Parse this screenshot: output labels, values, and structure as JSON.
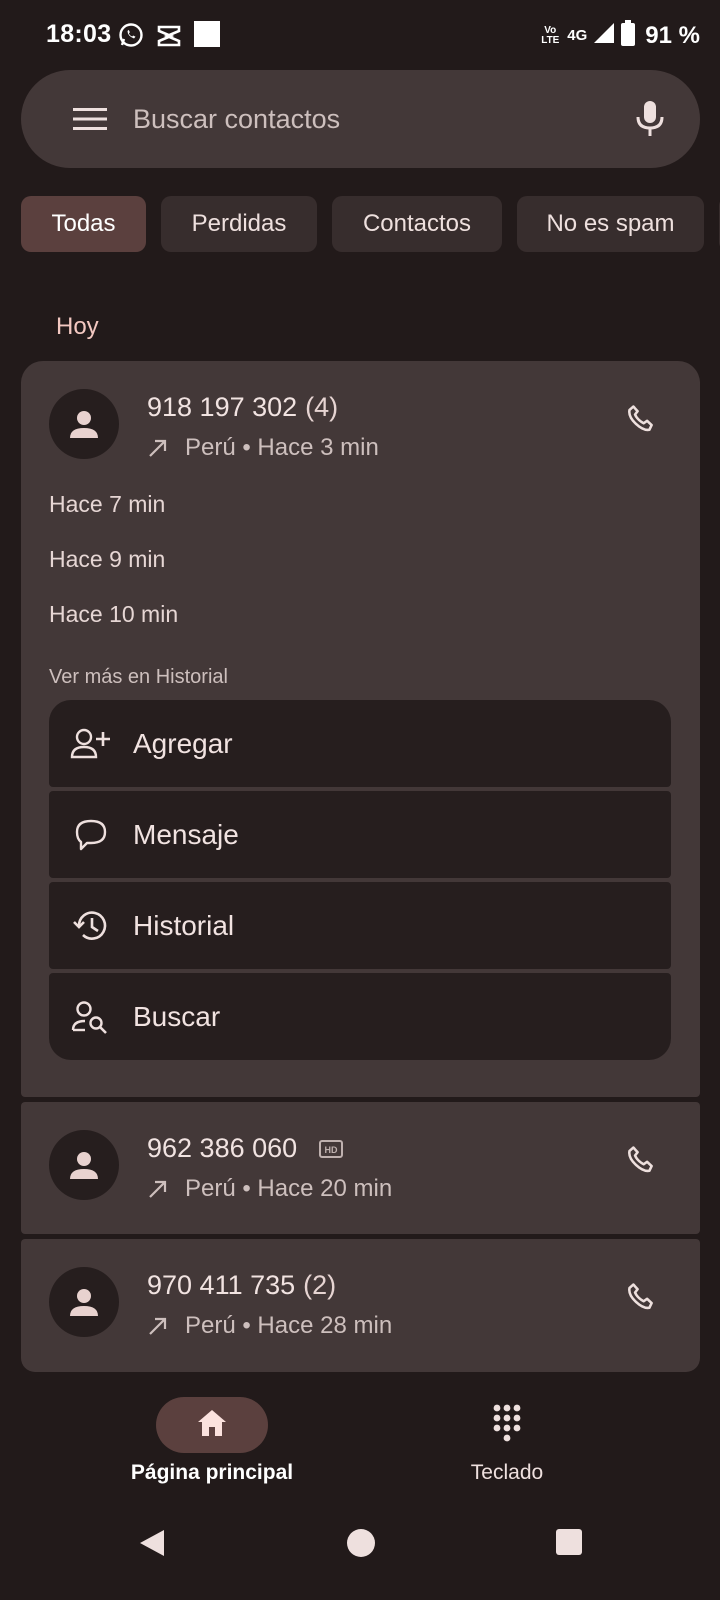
{
  "status_bar": {
    "time": "18:03",
    "left_icons": [
      "whatsapp-icon",
      "capcut-icon",
      "white-square-icon"
    ],
    "volte": "Vo LTE",
    "network": "4G",
    "battery": "91 %"
  },
  "search": {
    "placeholder": "Buscar contactos"
  },
  "filters": [
    {
      "label": "Todas",
      "active": true
    },
    {
      "label": "Perdidas",
      "active": false
    },
    {
      "label": "Contactos",
      "active": false
    },
    {
      "label": "No es spam",
      "active": false
    }
  ],
  "section": {
    "title": "Hoy"
  },
  "calls": [
    {
      "number": "918 197 302",
      "count": "(4)",
      "detail": "Perú • Hace 3 min",
      "history": [
        "Hace 7 min",
        "Hace 9 min",
        "Hace 10 min"
      ],
      "see_more": "Ver más en Historial",
      "actions": [
        {
          "label": "Agregar",
          "icon": "add-contact-icon"
        },
        {
          "label": "Mensaje",
          "icon": "message-icon"
        },
        {
          "label": "Historial",
          "icon": "history-icon"
        },
        {
          "label": "Buscar",
          "icon": "person-search-icon"
        }
      ]
    },
    {
      "number": "962 386 060",
      "badge": "HD",
      "detail": "Perú • Hace 20 min"
    },
    {
      "number": "970 411 735",
      "count": "(2)",
      "detail": "Perú • Hace 28 min"
    }
  ],
  "bottom_nav": {
    "home": "Página principal",
    "dialpad": "Teclado"
  },
  "colors": {
    "background": "#221a1a",
    "card": "#433838",
    "accent_chip": "#5b403e",
    "section_title": "#f3c8c1"
  }
}
